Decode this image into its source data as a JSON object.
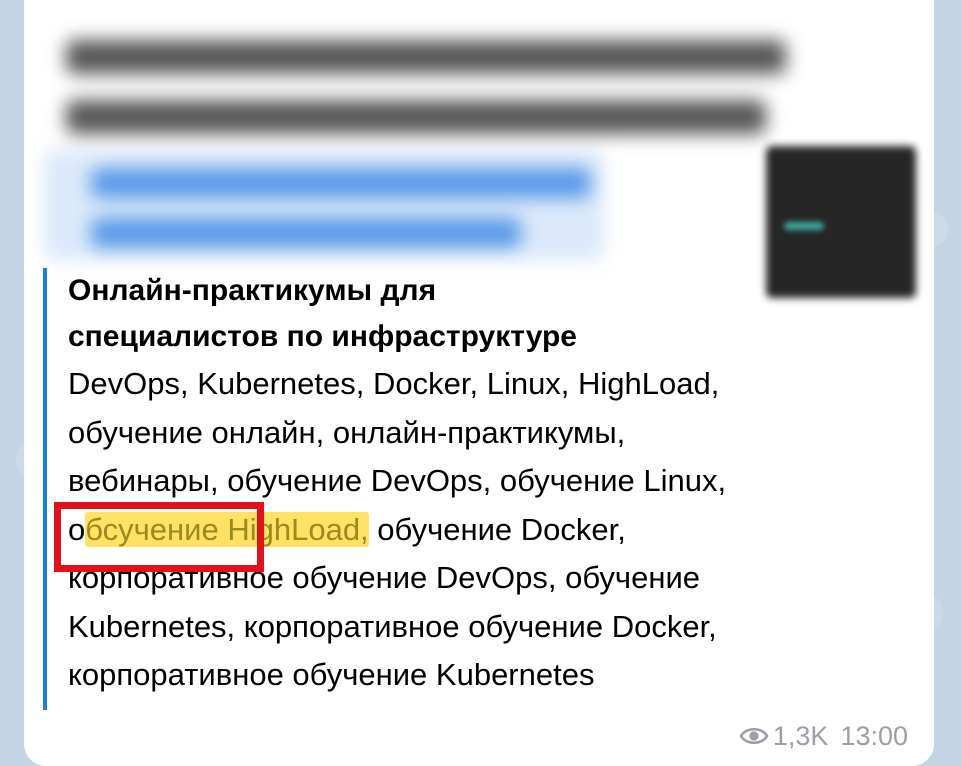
{
  "link_preview": {
    "title_lines": [
      "Онлайн-практикумы для",
      "специалистов по инфраструктуре"
    ],
    "description_lines": [
      "DevOps, Kubernetes, Docker, Linux, HighLoad,",
      "обучение онлайн, онлайн-практикумы,",
      "вебинары, обучение DevOps, обучение Linux,",
      {
        "before": "о",
        "highlighted": "бсучение HighLoad,",
        "after": " обучение Docker,"
      },
      "корпоративное обучение DevOps, обучение",
      "Kubernetes, корпоративное обучение Docker,",
      "корпоративное обучение Kubernetes"
    ]
  },
  "message_meta": {
    "views": "1,3K",
    "time": "13:00"
  },
  "colors": {
    "accent_bar": "#1a7ee0",
    "highlight": "#ffd728",
    "annotation_box": "#e1121b",
    "meta_text": "#9aa0a6"
  },
  "icons": {
    "views": "eye-icon"
  }
}
